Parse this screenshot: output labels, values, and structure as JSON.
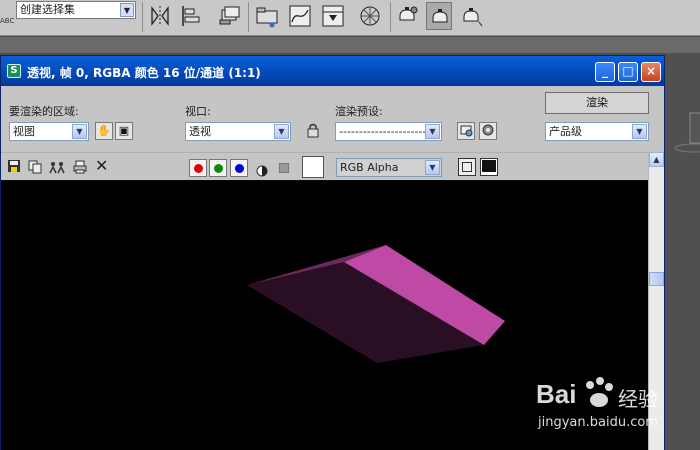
{
  "toolbar": {
    "selection_set": "创建选择集",
    "abc_label": "ABC",
    "icons": [
      "mirror-icon",
      "align-icon",
      "layer-manager-icon",
      "schematic-view-icon",
      "curve-editor-icon",
      "material-editor-icon",
      "render-setup-icon",
      "render-frame-icon",
      "quick-render-icon"
    ]
  },
  "window": {
    "title": "透视, 帧 0, RGBA 颜色 16 位/通道 (1:1)",
    "minimize": "_",
    "maximize": "□",
    "close": "×"
  },
  "controls": {
    "area_label": "要渲染的区域:",
    "area_value": "视图",
    "viewport_label": "视口:",
    "viewport_value": "透视",
    "preset_label": "渲染预设:",
    "preset_value": "----------------------",
    "render_button": "渲染",
    "quality_value": "产品级"
  },
  "channels": {
    "channel_value": "RGB Alpha",
    "colors": {
      "red": "#e00000",
      "green": "#0a8a0a",
      "blue": "#0000dd"
    }
  },
  "watermark": {
    "brand": "Bai",
    "brand_suffix": "经验",
    "url": "jingyan.baidu.com"
  },
  "colors": {
    "object_top": "#bf4aa6",
    "object_side": "#2a0f24",
    "titlebar": "#0548b8"
  }
}
